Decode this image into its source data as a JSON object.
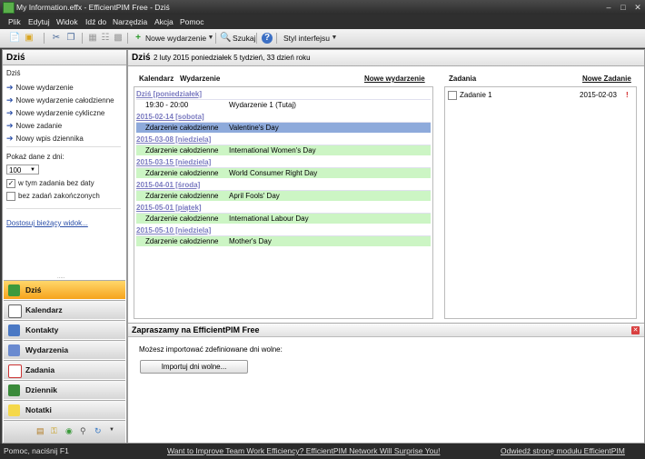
{
  "window": {
    "title": "My Information.effx - EfficientPIM Free - Dziś"
  },
  "menu": [
    "Plik",
    "Edytuj",
    "Widok",
    "Idź do",
    "Narzędzia",
    "Akcja",
    "Pomoc"
  ],
  "toolbar": {
    "new_event": "Nowe wydarzenie",
    "search": "Szukaj",
    "style": "Styl interfejsu"
  },
  "left": {
    "title": "Dziś",
    "subtitle": "Dziś",
    "tasks": [
      "Nowe wydarzenie",
      "Nowe wydarzenie całodzienne",
      "Nowe wydarzenie cykliczne",
      "Nowe zadanie",
      "Nowy wpis dziennika"
    ],
    "show_days_label": "Pokaż dane z dni:",
    "days_value": "100",
    "include_undated": "w tym zadania bez daty",
    "exclude_completed": "bez zadań zakończonych",
    "customize_link": "Dostosuj bieżący widok..."
  },
  "nav": [
    "Dziś",
    "Kalendarz",
    "Kontakty",
    "Wydarzenia",
    "Zadania",
    "Dziennik",
    "Notatki"
  ],
  "main": {
    "header_title": "Dziś",
    "header_date": "2 luty 2015 poniedziałek   5 tydzień,  33 dzień roku",
    "cal_col1": "Kalendarz",
    "cal_col2": "Wydarzenie",
    "new_event_link": "Nowe wydarzenie",
    "groups": [
      {
        "date": "Dziś [poniedziałek]",
        "time": "19:30 - 20:00",
        "desc": "Wydarzenie 1 (Tutaj)",
        "style": "normal"
      },
      {
        "date": "2015-02-14 [sobota]",
        "time": "Zdarzenie całodzienne",
        "desc": "Valentine's Day",
        "style": "selected"
      },
      {
        "date": "2015-03-08 [niedziela]",
        "time": "Zdarzenie całodzienne",
        "desc": "International Women's Day",
        "style": "green"
      },
      {
        "date": "2015-03-15 [niedziela]",
        "time": "Zdarzenie całodzienne",
        "desc": "World Consumer Right Day",
        "style": "green"
      },
      {
        "date": "2015-04-01 [środa]",
        "time": "Zdarzenie całodzienne",
        "desc": "April Fools' Day",
        "style": "green"
      },
      {
        "date": "2015-05-01 [piątek]",
        "time": "Zdarzenie całodzienne",
        "desc": "International Labour Day",
        "style": "green"
      },
      {
        "date": "2015-05-10 [niedziela]",
        "time": "Zdarzenie całodzienne",
        "desc": "Mother's Day",
        "style": "green"
      }
    ],
    "tasks_col": "Zadania",
    "new_task_link": "Nowe Zadanie",
    "task_items": [
      {
        "name": "Zadanie 1",
        "date": "2015-02-03"
      }
    ],
    "welcome_title": "Zapraszamy na EfficientPIM Free",
    "welcome_text": "Możesz importować zdefiniowane dni wolne:",
    "import_button": "Importuj dni wolne..."
  },
  "status": {
    "left": "Pomoc, naciśnij F1",
    "center": "Want to Improve Team Work Efficiency? EfficientPIM Network Will Surprise You!",
    "right": "Odwiedź stronę modułu EfficientPIM"
  },
  "colors": {
    "selected": "#8eaadb",
    "green": "#ccf5c4",
    "active_nav": "#f6a31c"
  }
}
